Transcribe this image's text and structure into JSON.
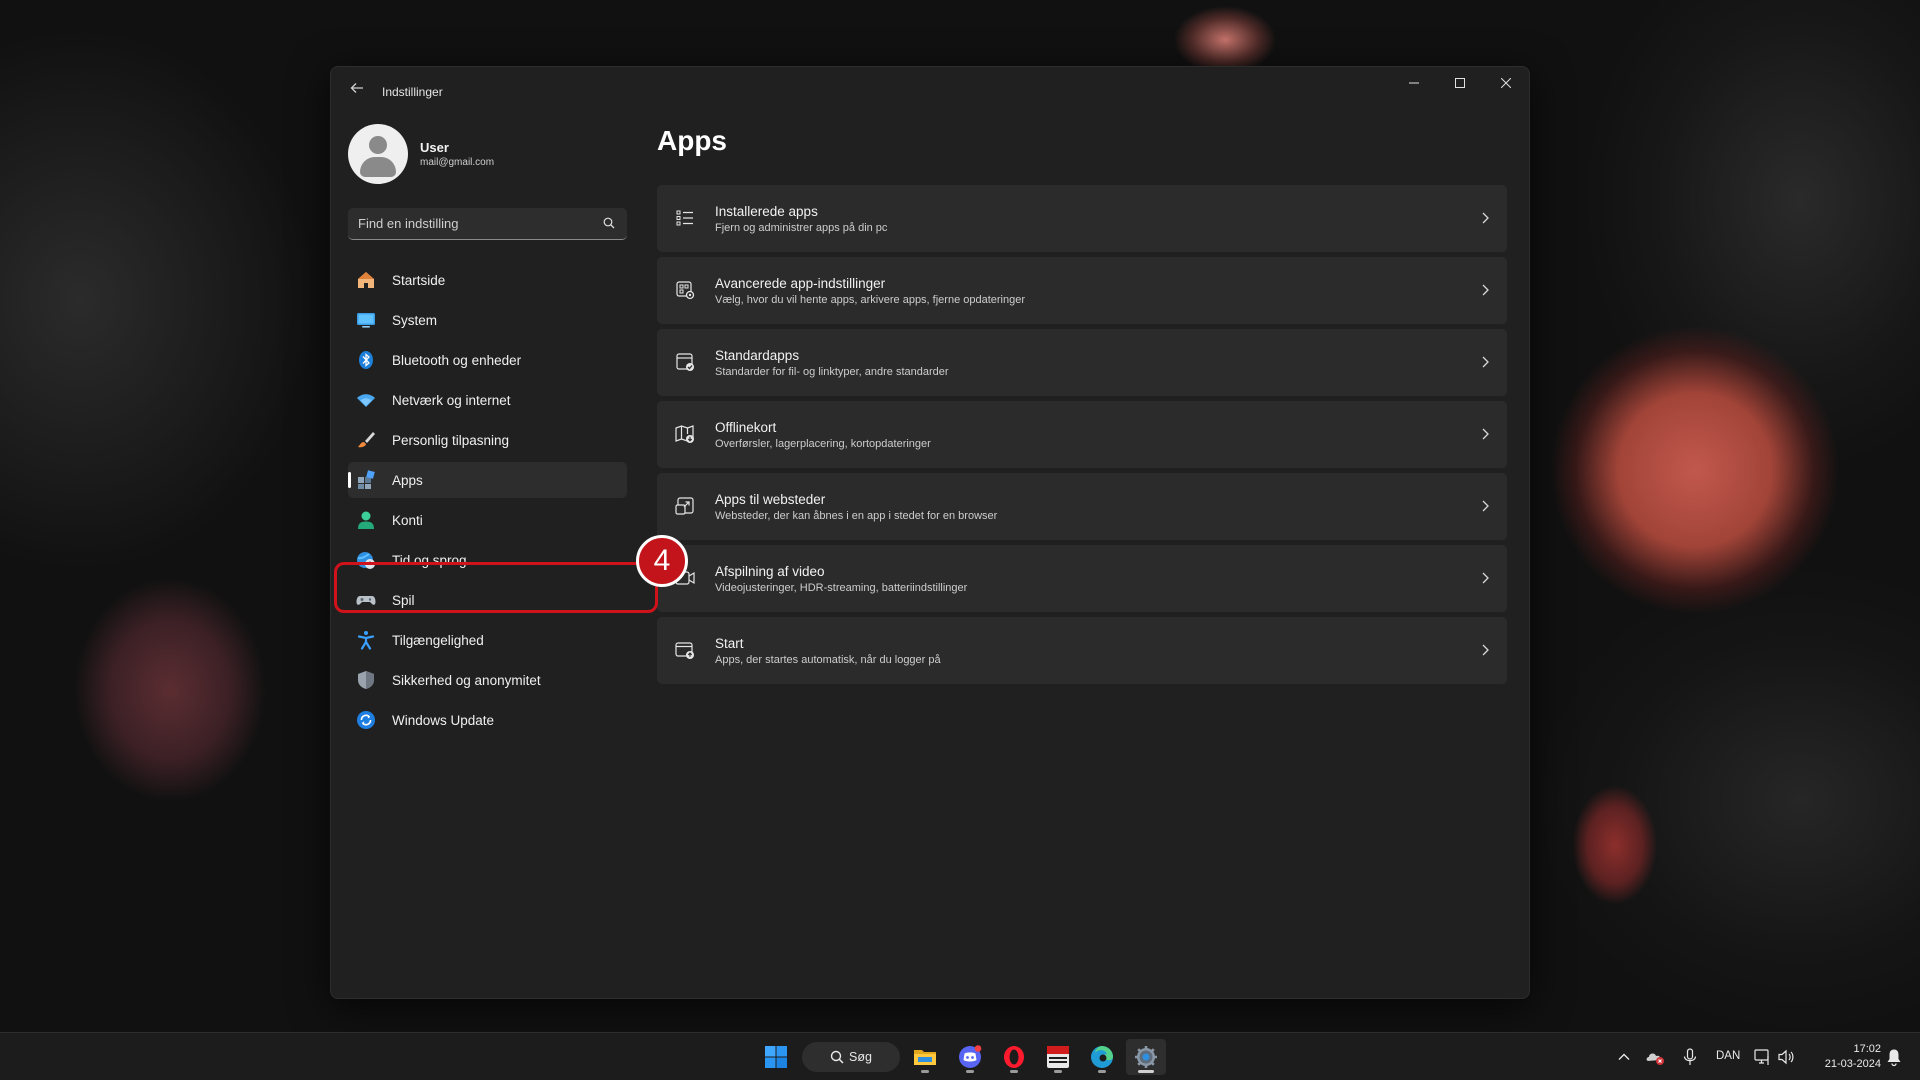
{
  "window": {
    "title": "Indstillinger",
    "controls": [
      "minimize",
      "maximize",
      "close"
    ]
  },
  "user": {
    "name": "User",
    "email": "mail@gmail.com"
  },
  "search": {
    "placeholder": "Find en indstilling"
  },
  "nav": {
    "items": [
      {
        "label": "Startside",
        "icon": "home-icon"
      },
      {
        "label": "System",
        "icon": "monitor-icon"
      },
      {
        "label": "Bluetooth og enheder",
        "icon": "bluetooth-icon"
      },
      {
        "label": "Netværk og internet",
        "icon": "wifi-icon"
      },
      {
        "label": "Personlig tilpasning",
        "icon": "paintbrush-icon"
      },
      {
        "label": "Apps",
        "icon": "apps-icon",
        "active": true
      },
      {
        "label": "Konti",
        "icon": "person-icon"
      },
      {
        "label": "Tid og sprog",
        "icon": "globe-clock-icon"
      },
      {
        "label": "Spil",
        "icon": "gamepad-icon"
      },
      {
        "label": "Tilgængelighed",
        "icon": "accessibility-icon"
      },
      {
        "label": "Sikkerhed og anonymitet",
        "icon": "shield-icon"
      },
      {
        "label": "Windows Update",
        "icon": "update-icon"
      }
    ]
  },
  "main": {
    "title": "Apps",
    "cards": [
      {
        "title": "Installerede apps",
        "desc": "Fjern og administrer apps på din pc",
        "icon": "list-icon"
      },
      {
        "title": "Avancerede app-indstillinger",
        "desc": "Vælg, hvor du vil hente apps, arkivere apps, fjerne opdateringer",
        "icon": "app-settings-icon"
      },
      {
        "title": "Standardapps",
        "desc": "Standarder for fil- og linktyper, andre standarder",
        "icon": "default-apps-icon"
      },
      {
        "title": "Offlinekort",
        "desc": "Overførsler, lagerplacering, kortopdateringer",
        "icon": "map-icon"
      },
      {
        "title": "Apps til websteder",
        "desc": "Websteder, der kan åbnes i en app i stedet for en browser",
        "icon": "open-in-app-icon"
      },
      {
        "title": "Afspilning af video",
        "desc": "Videojusteringer, HDR-streaming, batteriindstillinger",
        "icon": "video-icon"
      },
      {
        "title": "Start",
        "desc": "Apps, der startes automatisk, når du logger på",
        "icon": "startup-icon"
      }
    ]
  },
  "annotation": {
    "step": "4",
    "color": "#d0121b"
  },
  "taskbar": {
    "search_label": "Søg",
    "apps": [
      "windows-start-icon",
      "file-explorer-icon",
      "discord-icon",
      "opera-icon",
      "voicemeeter-icon",
      "edge-icon",
      "settings-icon"
    ],
    "tray": {
      "language": "DAN",
      "time": "17:02",
      "date": "21-03-2024"
    }
  },
  "colors": {
    "accent": "#4cc2ff",
    "window_bg": "#202020",
    "card_bg": "#2b2b2b"
  }
}
